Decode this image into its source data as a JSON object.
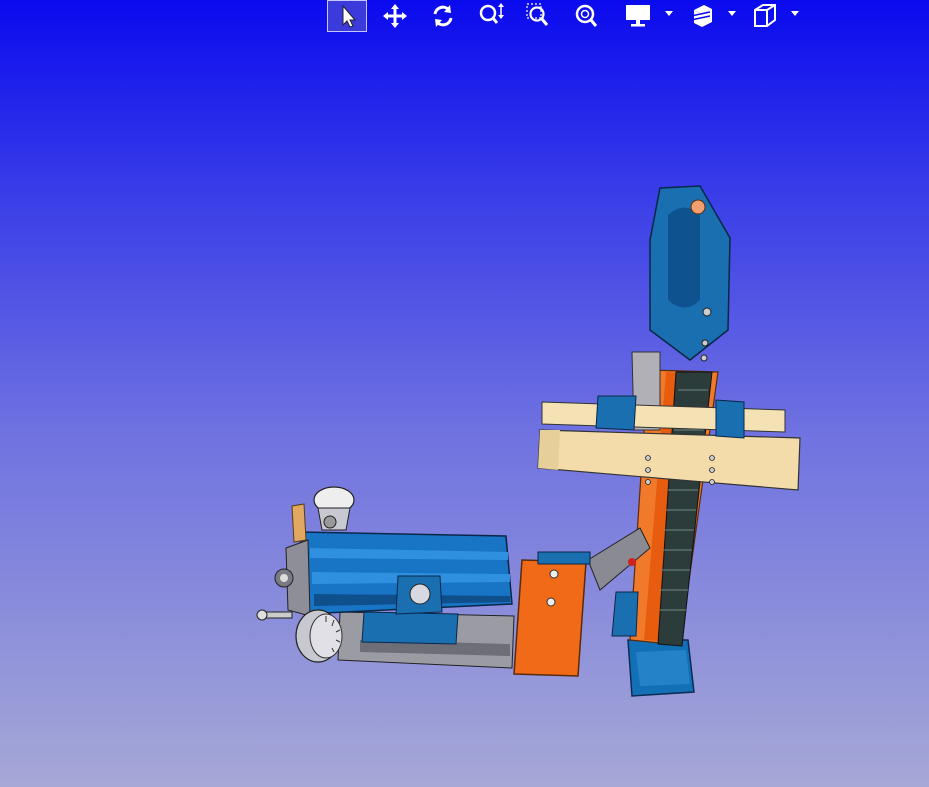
{
  "app": {
    "view": "3d-model-viewer",
    "background": {
      "top": "#0a0aee",
      "bottom": "#a6a8d6"
    }
  },
  "toolbar": {
    "buttons": [
      {
        "id": "select",
        "icon": "arrow-pointer-icon",
        "active": true
      },
      {
        "id": "pan",
        "icon": "move-arrows-icon"
      },
      {
        "id": "rotate",
        "icon": "rotate-icon"
      },
      {
        "id": "zoom",
        "icon": "zoom-updown-icon"
      },
      {
        "id": "zoom-window",
        "icon": "zoom-window-icon"
      },
      {
        "id": "zoom-fit",
        "icon": "zoom-fit-icon"
      },
      {
        "id": "display-mode",
        "icon": "monitor-icon",
        "dropdown": true
      },
      {
        "id": "sectioning",
        "icon": "section-planes-icon",
        "dropdown": true
      },
      {
        "id": "standard-views",
        "icon": "cube-icon",
        "dropdown": true
      }
    ]
  },
  "model": {
    "colors": {
      "blue": "#1566b8",
      "orange": "#f06a18",
      "tan": "#f3e0b2",
      "grey": "#9b9ba4",
      "dark": "#222a33"
    }
  }
}
